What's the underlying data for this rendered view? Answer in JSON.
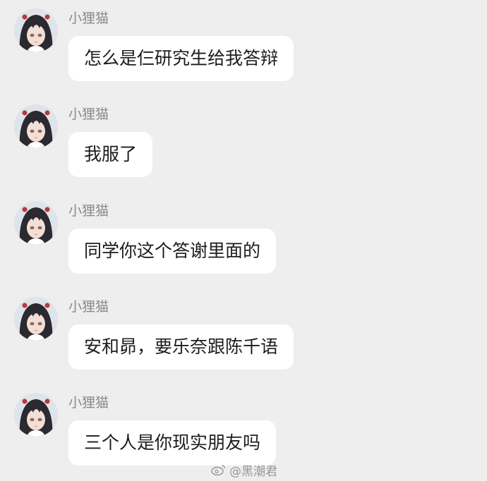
{
  "messages": [
    {
      "sender": "小狸猫",
      "text": "怎么是仨研究生给我答辩"
    },
    {
      "sender": "小狸猫",
      "text": "我服了"
    },
    {
      "sender": "小狸猫",
      "text": "同学你这个答谢里面的"
    },
    {
      "sender": "小狸猫",
      "text": "安和昴，要乐奈跟陈千语"
    },
    {
      "sender": "小狸猫",
      "text": "三个人是你现实朋友吗"
    }
  ],
  "avatar_icon": "anime-girl-avatar",
  "watermark": {
    "icon": "weibo-logo",
    "text": "@黑潮君"
  },
  "colors": {
    "background": "#eeeeee",
    "bubble": "#ffffff",
    "sender": "#8a8a8a",
    "text": "#1c1c1c"
  }
}
